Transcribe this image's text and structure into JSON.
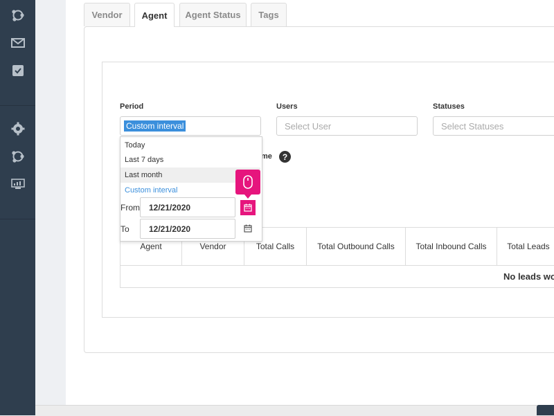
{
  "sidebar": {
    "icons": [
      "share-icon",
      "mail-icon",
      "task-icon",
      "gear-icon",
      "share-icon",
      "monitor-chart-icon"
    ]
  },
  "tabs": [
    {
      "label": "Vendor"
    },
    {
      "label": "Agent"
    },
    {
      "label": "Agent Status"
    },
    {
      "label": "Tags"
    }
  ],
  "filters": {
    "period_label": "Period",
    "period_value": "Custom interval",
    "users_label": "Users",
    "users_placeholder": "Select User",
    "statuses_label": "Statuses",
    "statuses_placeholder": "Select Statuses",
    "partial_label": "me"
  },
  "dropdown": {
    "options": [
      "Today",
      "Last 7 days",
      "Last month",
      "Custom interval"
    ],
    "from_label": "From",
    "from_value": "12/21/2020",
    "to_label": "To",
    "to_value": "12/21/2020"
  },
  "table": {
    "headers": [
      "Agent",
      "Vendor",
      "Total Calls",
      "Total Outbound Calls",
      "Total Inbound Calls",
      "Total Leads"
    ],
    "empty_text": "No leads wo"
  },
  "colors": {
    "sidebar": "#2f3e4e",
    "accent": "#3b8fdc",
    "highlight": "#e6157d"
  }
}
